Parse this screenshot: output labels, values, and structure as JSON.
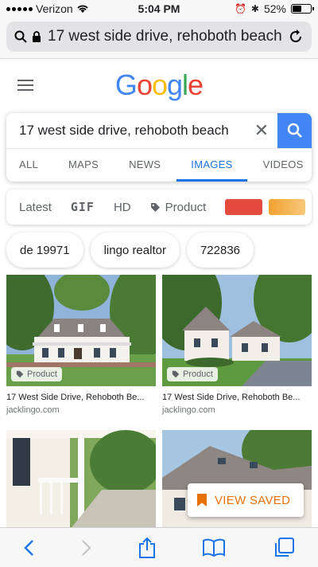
{
  "status_bar": {
    "carrier": "Verizon",
    "time": "5:04 PM",
    "battery": "52%",
    "battery_level": 0.52
  },
  "url_bar": {
    "url": "17 west side drive, rehoboth beach"
  },
  "logo": {
    "letters": [
      "G",
      "o",
      "o",
      "g",
      "l",
      "e"
    ],
    "colors": [
      "#4285f4",
      "#ea4335",
      "#fbbc05",
      "#4285f4",
      "#34a853",
      "#ea4335"
    ]
  },
  "search": {
    "query": "17 west side drive, rehoboth beach",
    "clear_symbol": "✕"
  },
  "tabs": [
    {
      "label": "ALL",
      "active": false
    },
    {
      "label": "MAPS",
      "active": false
    },
    {
      "label": "NEWS",
      "active": false
    },
    {
      "label": "IMAGES",
      "active": true
    },
    {
      "label": "VIDEOS",
      "active": false
    }
  ],
  "filters": {
    "latest": "Latest",
    "gif": "GIF",
    "hd": "HD",
    "product": "Product",
    "swatches": [
      "#e34b3f",
      "#f4a131"
    ]
  },
  "chips": [
    "de 19971",
    "lingo realtor",
    "722836"
  ],
  "results": [
    {
      "badge": "Product",
      "title": "17 West Side Drive, Rehoboth Be...",
      "domain": "jacklingo.com"
    },
    {
      "badge": "Product",
      "title": "17 West Side Drive, Rehoboth Be...",
      "domain": "jacklingo.com"
    },
    {
      "badge": "",
      "title": "",
      "domain": ""
    },
    {
      "badge": "",
      "title": "",
      "domain": ""
    }
  ],
  "view_saved": {
    "label": "VIEW SAVED"
  },
  "colors": {
    "accent": "#1a73e8",
    "search_button": "#4285f4",
    "saved_orange": "#e8710a"
  }
}
